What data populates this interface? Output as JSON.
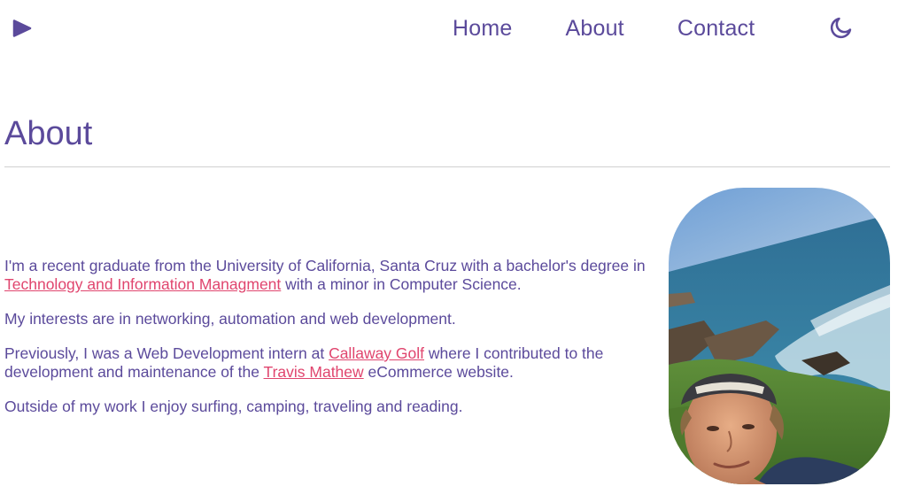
{
  "header": {
    "logo_icon": "play-triangle-icon",
    "nav": [
      {
        "label": "Home"
      },
      {
        "label": "About"
      },
      {
        "label": "Contact"
      }
    ],
    "theme_toggle_icon": "moon-icon"
  },
  "page": {
    "title": "About"
  },
  "bio": {
    "p1_before": "I'm a recent graduate from the University of California, Santa Cruz with a bachelor's degree in ",
    "p1_link": "Technology and Information Managment",
    "p1_after": " with a minor in Computer Science.",
    "p2": "My interests are in networking, automation and web development.",
    "p3_before": "Previously, I was a Web Development intern at ",
    "p3_link1": "Callaway Golf",
    "p3_middle": " where I contributed to the development and maintenance of the ",
    "p3_link2": "Travis Mathew",
    "p3_after": " eCommerce website.",
    "p4": "Outside of my work I enjoy surfing, camping, traveling and reading."
  },
  "colors": {
    "primary": "#5b4a9b",
    "link": "#e0456e",
    "divider": "#d0d0d0",
    "background": "#ffffff"
  }
}
